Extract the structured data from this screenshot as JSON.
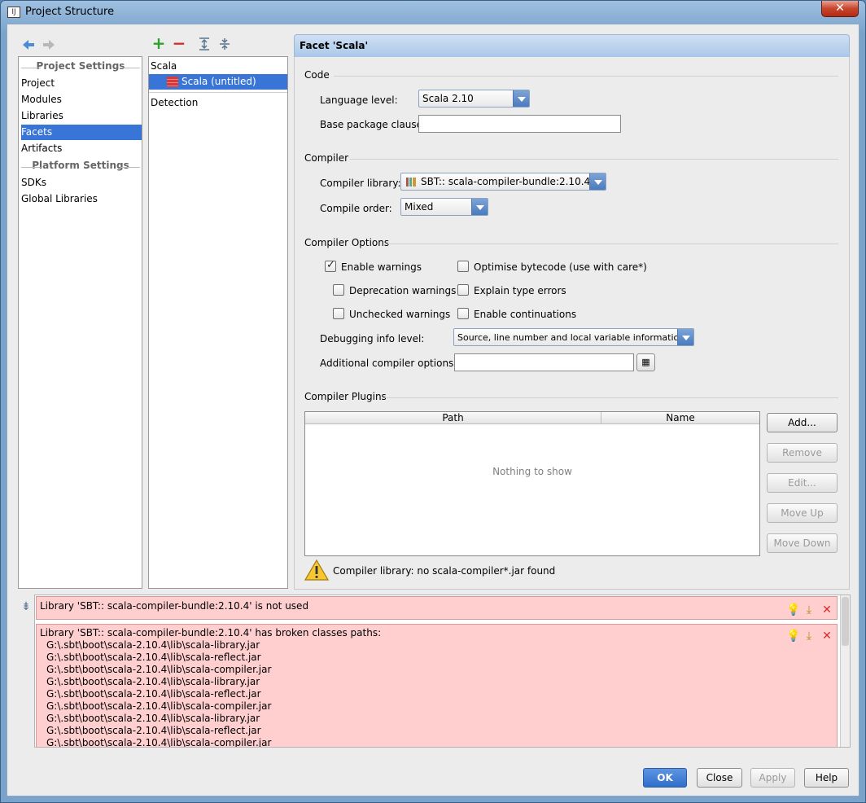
{
  "window": {
    "title": "Project Structure",
    "close": "✕"
  },
  "toolbar": {
    "back": "back-icon",
    "forward": "forward-icon",
    "add": "+",
    "remove": "−",
    "expand": "expand-all-icon",
    "collapse": "collapse-all-icon"
  },
  "nav": {
    "project_settings": "Project Settings",
    "platform_settings": "Platform Settings",
    "items": [
      "Project",
      "Modules",
      "Libraries",
      "Facets",
      "Artifacts",
      "SDKs",
      "Global Libraries"
    ],
    "selected": "Facets"
  },
  "tree": {
    "group": "Scala",
    "child": "Scala (untitled)",
    "detection": "Detection"
  },
  "facet": {
    "header": "Facet 'Scala'",
    "code": {
      "title": "Code",
      "language_level_label": "Language level:",
      "language_level_value": "Scala 2.10",
      "base_package_label": "Base package clause:",
      "base_package_value": ""
    },
    "compiler": {
      "title": "Compiler",
      "library_label": "Compiler library:",
      "library_value": "SBT:: scala-compiler-bundle:2.10.4",
      "order_label": "Compile order:",
      "order_value": "Mixed"
    },
    "options": {
      "title": "Compiler Options",
      "enable_warnings": "Enable warnings",
      "deprecation_warnings": "Deprecation warnings",
      "unchecked_warnings": "Unchecked warnings",
      "optimise": "Optimise bytecode (use with care*)",
      "explain": "Explain type errors",
      "continuations": "Enable continuations",
      "enable_warnings_checked": true,
      "debug_label": "Debugging info level:",
      "debug_value": "Source, line number and local variable information",
      "additional_label": "Additional compiler options:",
      "additional_value": ""
    },
    "plugins": {
      "title": "Compiler Plugins",
      "columns": [
        "Path",
        "Name"
      ],
      "empty": "Nothing to show",
      "buttons": {
        "add": "Add...",
        "remove": "Remove",
        "edit": "Edit...",
        "move_up": "Move Up",
        "move_down": "Move Down"
      }
    },
    "warning": "Compiler library: no scala-compiler*.jar found"
  },
  "problems": [
    {
      "text": "Library 'SBT:: scala-compiler-bundle:2.10.4' is not used"
    },
    {
      "text": "Library 'SBT:: scala-compiler-bundle:2.10.4' has broken classes paths:",
      "paths": [
        "G:\\.sbt\\boot\\scala-2.10.4\\lib\\scala-library.jar",
        "G:\\.sbt\\boot\\scala-2.10.4\\lib\\scala-reflect.jar",
        "G:\\.sbt\\boot\\scala-2.10.4\\lib\\scala-compiler.jar",
        "G:\\.sbt\\boot\\scala-2.10.4\\lib\\scala-library.jar",
        "G:\\.sbt\\boot\\scala-2.10.4\\lib\\scala-reflect.jar",
        "G:\\.sbt\\boot\\scala-2.10.4\\lib\\scala-compiler.jar",
        "G:\\.sbt\\boot\\scala-2.10.4\\lib\\scala-library.jar",
        "G:\\.sbt\\boot\\scala-2.10.4\\lib\\scala-reflect.jar",
        "G:\\.sbt\\boot\\scala-2.10.4\\lib\\scala-compiler.jar"
      ]
    }
  ],
  "footer": {
    "ok": "OK",
    "close": "Close",
    "apply": "Apply",
    "help": "Help"
  },
  "colors": {
    "accent": "#3875d7",
    "error_bg": "#ffcfcf",
    "header": "#aac7e8"
  }
}
